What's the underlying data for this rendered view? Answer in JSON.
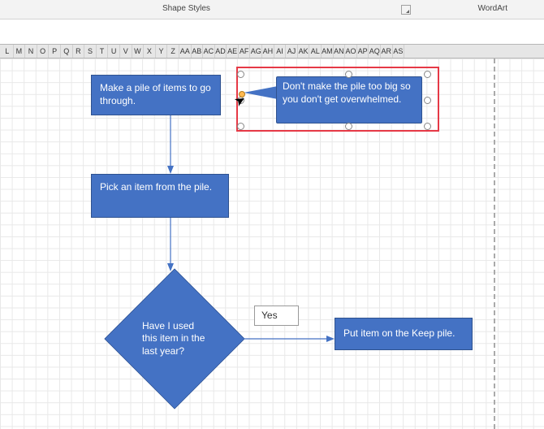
{
  "ribbon": {
    "group_left": "Shape Styles",
    "group_right": "WordArt"
  },
  "columns": [
    "L",
    "M",
    "N",
    "O",
    "P",
    "Q",
    "R",
    "S",
    "T",
    "U",
    "V",
    "W",
    "X",
    "Y",
    "Z",
    "AA",
    "AB",
    "AC",
    "AD",
    "AE",
    "AF",
    "AG",
    "AH",
    "AI",
    "AJ",
    "AK",
    "AL",
    "AM",
    "AN",
    "AO",
    "AP",
    "AQ",
    "AR",
    "AS"
  ],
  "flowchart": {
    "step1": "Make a pile of items to go through.",
    "step2": "Pick an item from the pile.",
    "decision": "Have I used this item in the last year?",
    "yes_label": "Yes",
    "keep": "Put item on the Keep pile.",
    "callout": "Don't make the pile too big so you don't get overwhelmed."
  }
}
